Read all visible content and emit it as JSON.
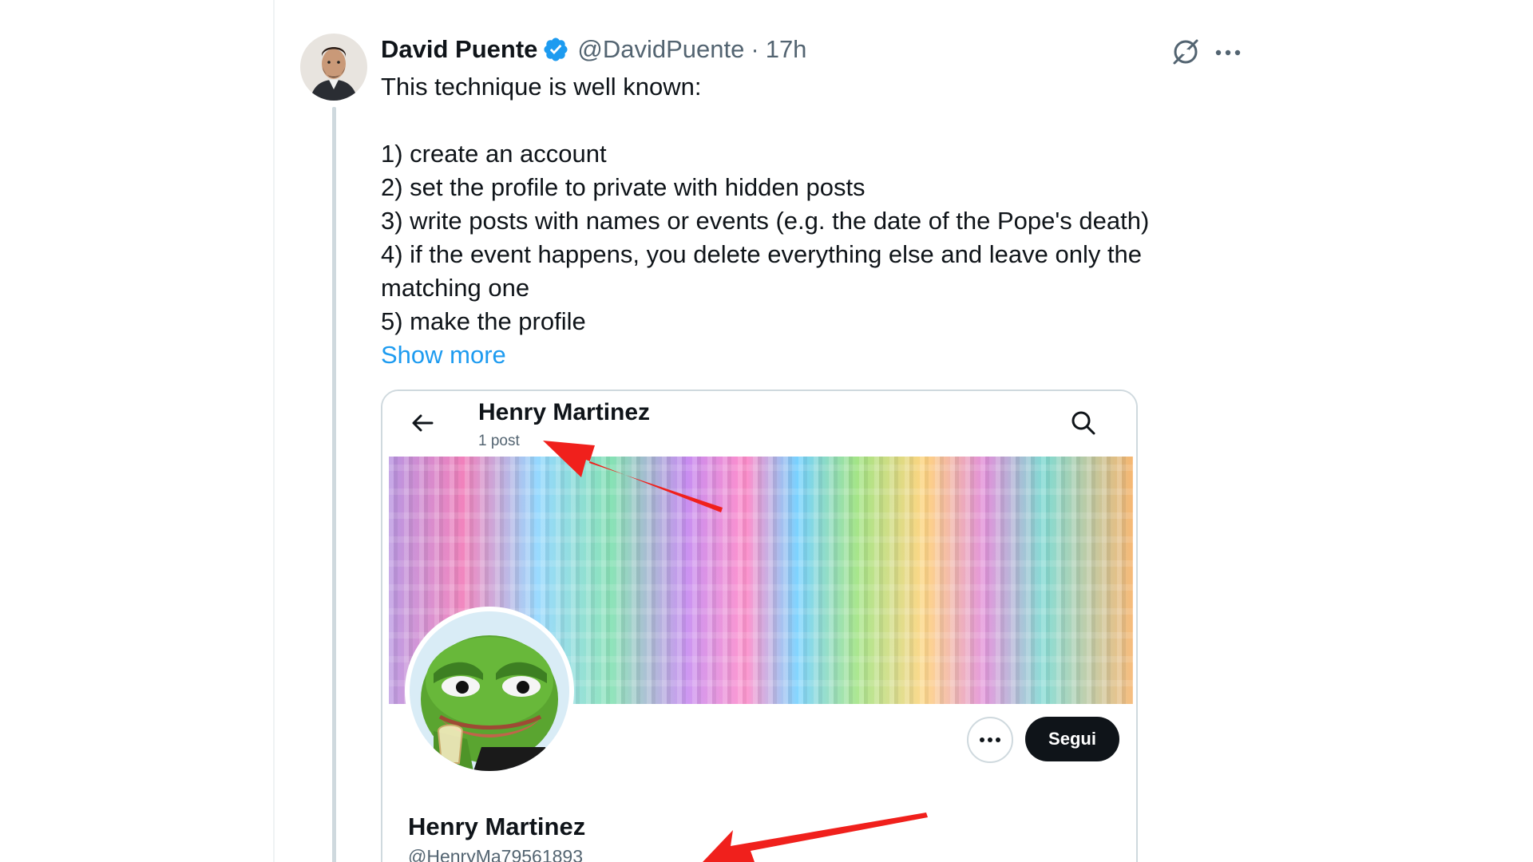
{
  "tweet": {
    "author_name": "David Puente",
    "handle": "@DavidPuente",
    "separator": "·",
    "time": "17h",
    "lines": [
      "This technique is well known:",
      "",
      "1) create an account",
      "2) set the profile to private with hidden posts",
      "3) write posts with names or events (e.g. the date of the Pope's death)",
      "4) if the event happens, you delete everything else and leave only the",
      "matching one",
      "5) make the profile"
    ],
    "show_more": "Show more"
  },
  "embed": {
    "title": "Henry Martinez",
    "post_count": "1 post",
    "follow_label": "Segui",
    "profile_name": "Henry Martinez",
    "profile_handle": "@HenryMa79561893"
  },
  "colors": {
    "link": "#1d9bf0",
    "verified": "#1d9bf0",
    "annotation_arrow": "#f0201c"
  },
  "icons": [
    "verified-badge-icon",
    "grok-icon",
    "more-options-icon",
    "back-arrow-icon",
    "search-icon"
  ]
}
